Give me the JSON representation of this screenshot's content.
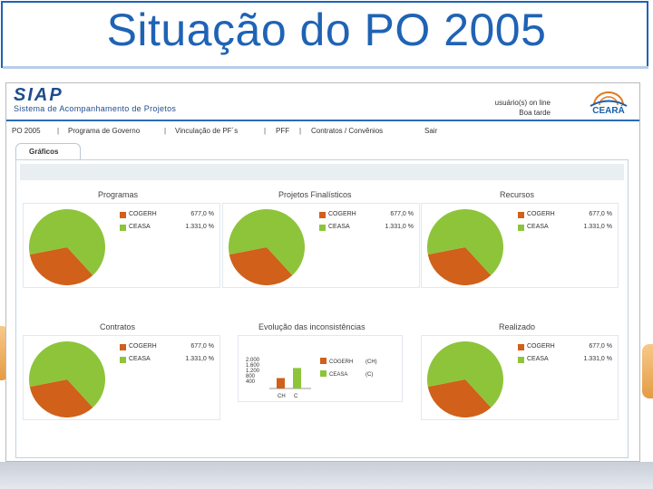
{
  "slide": {
    "title": "Situação do PO 2005"
  },
  "app": {
    "logo": "SIAP",
    "logo_subtitle": "Sistema de Acompanhamento de Projetos",
    "users_online": "usuário(s) on line",
    "greeting": "Boa tarde",
    "ceara_logo": "CEARÁ",
    "menu": [
      "PO 2005",
      "Programa de Governo",
      "Vinculação de PF´s",
      "PFF",
      "Contratos / Convênios",
      "Sair"
    ],
    "menu_separator": "|",
    "active_tab": "Gráficos"
  },
  "colors": {
    "cogerh": "#d0601a",
    "ceasa": "#8ec43a",
    "title_blue": "#1f63b5"
  },
  "charts": [
    {
      "title": "Programas",
      "legend": [
        {
          "label": "COGERH",
          "value": "677,0 %"
        },
        {
          "label": "CEASA",
          "value": "1.331,0 %"
        }
      ]
    },
    {
      "title": "Projetos Finalísticos",
      "legend": [
        {
          "label": "COGERH",
          "value": "677,0 %"
        },
        {
          "label": "CEASA",
          "value": "1.331,0 %"
        }
      ]
    },
    {
      "title": "Recursos",
      "legend": [
        {
          "label": "COGERH",
          "value": "677,0 %"
        },
        {
          "label": "CEASA",
          "value": "1.331,0 %"
        }
      ]
    },
    {
      "title": "Contratos",
      "legend": [
        {
          "label": "COGERH",
          "value": "677,0 %"
        },
        {
          "label": "CEASA",
          "value": "1.331,0 %"
        }
      ]
    },
    {
      "title": "Evolução das inconsistências",
      "legend": [
        {
          "label": "COGERH",
          "value": "(CH)"
        },
        {
          "label": "CEASA",
          "value": "(C)"
        }
      ]
    },
    {
      "title": "Realizado",
      "legend": [
        {
          "label": "COGERH",
          "value": "677,0 %"
        },
        {
          "label": "CEASA",
          "value": "1.331,0 %"
        }
      ]
    }
  ],
  "chart_data": [
    {
      "type": "pie",
      "title": "Programas",
      "labels": [
        "COGERH",
        "CEASA"
      ],
      "values": [
        677.0,
        1331.0
      ]
    },
    {
      "type": "pie",
      "title": "Projetos Finalísticos",
      "labels": [
        "COGERH",
        "CEASA"
      ],
      "values": [
        677.0,
        1331.0
      ]
    },
    {
      "type": "pie",
      "title": "Recursos",
      "labels": [
        "COGERH",
        "CEASA"
      ],
      "values": [
        677.0,
        1331.0
      ]
    },
    {
      "type": "pie",
      "title": "Contratos",
      "labels": [
        "COGERH",
        "CEASA"
      ],
      "values": [
        677.0,
        1331.0
      ]
    },
    {
      "type": "bar",
      "title": "Evolução das inconsistências",
      "categories": [
        "CH",
        "C"
      ],
      "values": [
        677,
        1331
      ],
      "yticks": [
        "2.000",
        "1.600",
        "1.200",
        "800",
        "400"
      ],
      "ylim": [
        0,
        2000
      ]
    },
    {
      "type": "pie",
      "title": "Realizado",
      "labels": [
        "COGERH",
        "CEASA"
      ],
      "values": [
        677.0,
        1331.0
      ]
    }
  ]
}
